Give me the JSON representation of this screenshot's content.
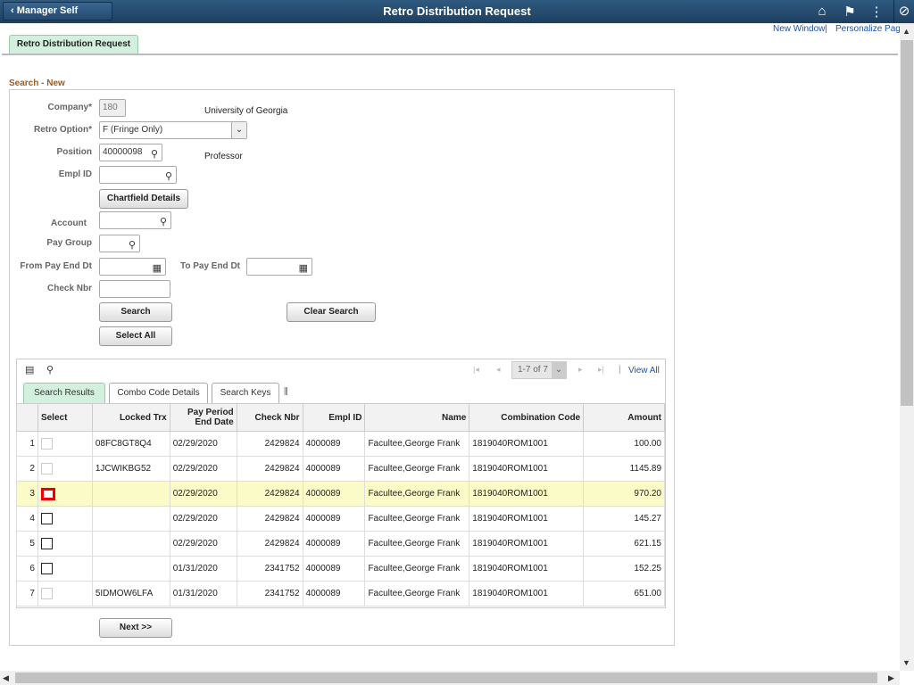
{
  "header": {
    "back_label": "Manager Self Service",
    "title": "Retro Distribution Request",
    "icons": [
      "home-icon",
      "flag-icon",
      "more-icon",
      "navbar-compass-icon"
    ]
  },
  "links": {
    "new_window": "New Window",
    "separator": "|",
    "personalize": "Personalize Page"
  },
  "page_tab": "Retro Distribution Request",
  "section_title": "Search - New",
  "form": {
    "company_label": "Company*",
    "company_value": "180",
    "company_desc": "University of Georgia",
    "retro_label": "Retro Option*",
    "retro_value": "F (Fringe Only)",
    "position_label": "Position",
    "position_value": "40000098",
    "position_desc": "Professor",
    "emplid_label": "Empl ID",
    "emplid_value": "",
    "chartfield_button": "Chartfield Details",
    "account_label": "Account",
    "paygroup_label": "Pay Group",
    "from_label": "From Pay End Dt",
    "to_label": "To Pay End Dt",
    "check_label": "Check Nbr",
    "search_button": "Search",
    "clear_button": "Clear Search",
    "select_all_button": "Select All"
  },
  "grid": {
    "pager": "1-7 of 7",
    "view_all": "View All",
    "pager_sep": "|",
    "tabs": [
      "Search Results",
      "Combo Code Details",
      "Search Keys"
    ],
    "columns": [
      "",
      "Select",
      "Locked Trx",
      "Pay Period End Date",
      "Check Nbr",
      "Empl ID",
      "Name",
      "Combination Code",
      "Amount"
    ],
    "rows": [
      {
        "n": "1",
        "select": "disabled",
        "locked": "08FC8GT8Q4",
        "date": "02/29/2020",
        "check": "2429824",
        "empl": "4000089",
        "name": "Facultee,George Frank",
        "combo": "1819040ROM1001",
        "amount": "100.00"
      },
      {
        "n": "2",
        "select": "disabled",
        "locked": "1JCWIKBG52",
        "date": "02/29/2020",
        "check": "2429824",
        "empl": "4000089",
        "name": "Facultee,George Frank",
        "combo": "1819040ROM1001",
        "amount": "1145.89"
      },
      {
        "n": "3",
        "select": "focused",
        "locked": "",
        "date": "02/29/2020",
        "check": "2429824",
        "empl": "4000089",
        "name": "Facultee,George Frank",
        "combo": "1819040ROM1001",
        "amount": "970.20"
      },
      {
        "n": "4",
        "select": "unchecked",
        "locked": "",
        "date": "02/29/2020",
        "check": "2429824",
        "empl": "4000089",
        "name": "Facultee,George Frank",
        "combo": "1819040ROM1001",
        "amount": "145.27"
      },
      {
        "n": "5",
        "select": "unchecked",
        "locked": "",
        "date": "02/29/2020",
        "check": "2429824",
        "empl": "4000089",
        "name": "Facultee,George Frank",
        "combo": "1819040ROM1001",
        "amount": "621.15"
      },
      {
        "n": "6",
        "select": "unchecked",
        "locked": "",
        "date": "01/31/2020",
        "check": "2341752",
        "empl": "4000089",
        "name": "Facultee,George Frank",
        "combo": "1819040ROM1001",
        "amount": "152.25"
      },
      {
        "n": "7",
        "select": "disabled",
        "locked": "5IDMOW6LFA",
        "date": "01/31/2020",
        "check": "2341752",
        "empl": "4000089",
        "name": "Facultee,George Frank",
        "combo": "1819040ROM1001",
        "amount": "651.00"
      }
    ]
  },
  "next_button": "Next >>"
}
